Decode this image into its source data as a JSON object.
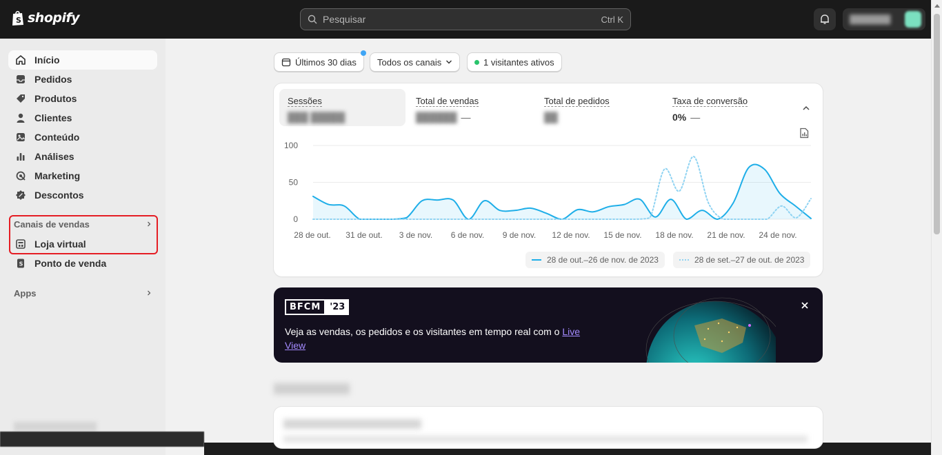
{
  "brand": {
    "name": "shopify"
  },
  "search": {
    "placeholder": "Pesquisar",
    "shortcut": "Ctrl K"
  },
  "nav": {
    "items": [
      {
        "label": "Início",
        "icon": "home-icon",
        "active": true
      },
      {
        "label": "Pedidos",
        "icon": "inbox-icon"
      },
      {
        "label": "Produtos",
        "icon": "tag-icon"
      },
      {
        "label": "Clientes",
        "icon": "person-icon"
      },
      {
        "label": "Conteúdo",
        "icon": "image-icon"
      },
      {
        "label": "Análises",
        "icon": "bar-chart-icon"
      },
      {
        "label": "Marketing",
        "icon": "target-icon"
      },
      {
        "label": "Descontos",
        "icon": "discount-icon"
      }
    ],
    "sales_channels": {
      "label": "Canais de vendas",
      "items": [
        {
          "label": "Loja virtual",
          "icon": "store-icon"
        },
        {
          "label": "Ponto de venda",
          "icon": "pos-icon"
        }
      ]
    },
    "apps": {
      "label": "Apps"
    }
  },
  "filters": {
    "date": "Últimos 30 dias",
    "channels": "Todos os canais",
    "visitors": "1 visitantes ativos"
  },
  "metrics": [
    {
      "label": "Sessões",
      "value": ""
    },
    {
      "label": "Total de vendas",
      "value": "",
      "delta": "—"
    },
    {
      "label": "Total de pedidos",
      "value": ""
    },
    {
      "label": "Taxa de conversão",
      "value": "0%",
      "delta": "—"
    }
  ],
  "chart_data": {
    "type": "line",
    "yticks": [
      0,
      50,
      100
    ],
    "ylim": [
      0,
      100
    ],
    "x_tick_labels": [
      "28 de out.",
      "31 de out.",
      "3 de nov.",
      "6 de nov.",
      "9 de nov.",
      "12 de nov.",
      "15 de nov.",
      "18 de nov.",
      "21 de nov.",
      "24 de nov."
    ],
    "series": [
      {
        "name": "28 de out.–26 de nov. de 2023",
        "style": "solid",
        "color": "#1eaee8",
        "values": [
          31,
          20,
          18,
          0,
          0,
          0,
          2,
          25,
          26,
          26,
          0,
          25,
          12,
          12,
          15,
          8,
          0,
          13,
          10,
          17,
          20,
          27,
          3,
          27,
          0,
          12,
          0,
          22,
          70,
          68,
          35,
          18,
          1
        ]
      },
      {
        "name": "28 de set.–27 de out. de 2023",
        "style": "dotted",
        "color": "#8fd3f2",
        "values": [
          0,
          0,
          0,
          0,
          0,
          0,
          0,
          0,
          0,
          0,
          0,
          0,
          0,
          0,
          0,
          0,
          0,
          0,
          0,
          0,
          0,
          0,
          0,
          2,
          68,
          38,
          85,
          22,
          0,
          0,
          0,
          0,
          18,
          2,
          28
        ]
      }
    ]
  },
  "banner": {
    "badge": "BFCM",
    "year": "'23",
    "text": "Veja as vendas, os pedidos e os visitantes em tempo real com o",
    "link": "Live View"
  },
  "colors": {
    "accent": "#1eaee8",
    "topbar": "#1a1a1a",
    "highlight": "#e51c23",
    "live": "#29c46c"
  }
}
